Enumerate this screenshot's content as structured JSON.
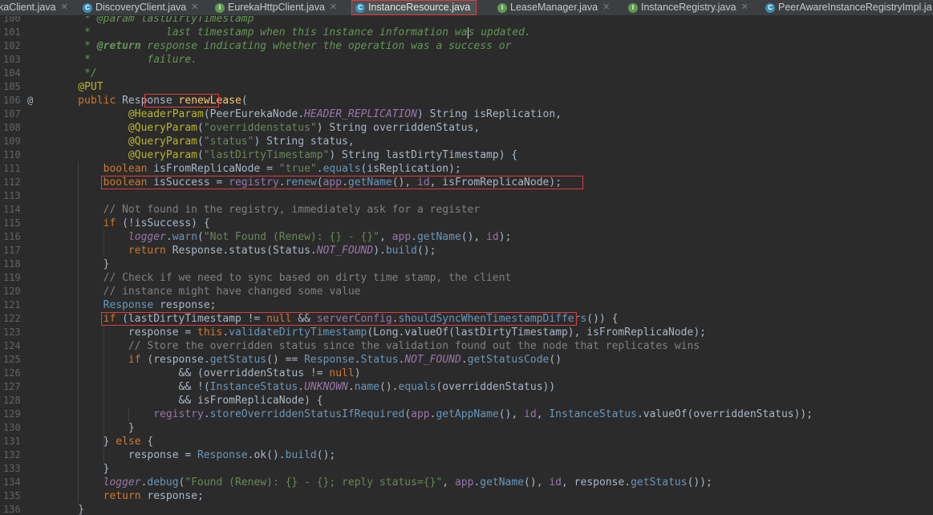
{
  "tabs": [
    {
      "label": "kaClient.java",
      "icon": "class-icon",
      "active": false
    },
    {
      "label": "DiscoveryClient.java",
      "icon": "class-icon",
      "active": false
    },
    {
      "label": "EurekaHttpClient.java",
      "icon": "interface-icon",
      "active": false
    },
    {
      "label": "InstanceResource.java",
      "icon": "class-icon",
      "active": true
    },
    {
      "label": "LeaseManager.java",
      "icon": "interface-icon",
      "active": false
    },
    {
      "label": "InstanceRegistry.java",
      "icon": "interface-icon",
      "active": false
    },
    {
      "label": "PeerAwareInstanceRegistryImpl.ja",
      "icon": "class-icon",
      "active": false
    }
  ],
  "colors": {
    "background": "#2b2b2b",
    "keyword": "#cc7832",
    "string": "#6a8759",
    "comment": "#629755",
    "annotation": "#bbb529",
    "highlight_box": "#e03c3c"
  },
  "lines": [
    {
      "n": "100",
      "tokens": [
        [
          "comment",
          "     * @param "
        ],
        [
          "comment",
          "lastDirtyTimestamp"
        ]
      ]
    },
    {
      "n": "101",
      "tokens": [
        [
          "comment",
          "     *            last timestamp when this instance information wa"
        ],
        [
          "caret",
          ""
        ],
        [
          "comment",
          "s updated."
        ]
      ]
    },
    {
      "n": "102",
      "tokens": [
        [
          "comment",
          "     * "
        ],
        [
          "tag",
          "@return"
        ],
        [
          "comment",
          " response indicating whether the operation was a success or"
        ]
      ]
    },
    {
      "n": "103",
      "tokens": [
        [
          "comment",
          "     *         failure."
        ]
      ]
    },
    {
      "n": "104",
      "tokens": [
        [
          "comment",
          "     */"
        ]
      ]
    },
    {
      "n": "105",
      "tokens": [
        [
          "annotation",
          "    @PUT"
        ]
      ]
    },
    {
      "n": "106",
      "mark": "@",
      "tokens": [
        [
          "keyword",
          "    public "
        ],
        [
          "default",
          "Response "
        ],
        [
          "static",
          "renewLease"
        ],
        [
          "default",
          "("
        ]
      ]
    },
    {
      "n": "107",
      "tokens": [
        [
          "annotation",
          "            @HeaderParam"
        ],
        [
          "default",
          "(PeerEurekaNode."
        ],
        [
          "const",
          "HEADER_REPLICATION"
        ],
        [
          "default",
          ") String isReplication,"
        ]
      ]
    },
    {
      "n": "108",
      "tokens": [
        [
          "annotation",
          "            @QueryParam"
        ],
        [
          "default",
          "("
        ],
        [
          "string",
          "\"overriddenstatus\""
        ],
        [
          "default",
          ") String overriddenStatus,"
        ]
      ]
    },
    {
      "n": "109",
      "tokens": [
        [
          "annotation",
          "            @QueryParam"
        ],
        [
          "default",
          "("
        ],
        [
          "string",
          "\"status\""
        ],
        [
          "default",
          ") String status,"
        ]
      ]
    },
    {
      "n": "110",
      "tokens": [
        [
          "annotation",
          "            @QueryParam"
        ],
        [
          "default",
          "("
        ],
        [
          "string",
          "\"lastDirtyTimestamp\""
        ],
        [
          "default",
          ") String lastDirtyTimestamp) {"
        ]
      ]
    },
    {
      "n": "111",
      "tokens": [
        [
          "keyword",
          "        boolean "
        ],
        [
          "default",
          "isFromReplicaNode = "
        ],
        [
          "string",
          "\"true\""
        ],
        [
          "default",
          "."
        ],
        [
          "method",
          "equals"
        ],
        [
          "default",
          "(isReplication);"
        ]
      ]
    },
    {
      "n": "112",
      "tokens": [
        [
          "keyword",
          "        boolean "
        ],
        [
          "default",
          "isSuccess = "
        ],
        [
          "field",
          "registry"
        ],
        [
          "default",
          "."
        ],
        [
          "method",
          "renew"
        ],
        [
          "default",
          "("
        ],
        [
          "field",
          "app"
        ],
        [
          "default",
          "."
        ],
        [
          "method",
          "getName"
        ],
        [
          "default",
          "(), "
        ],
        [
          "field",
          "id"
        ],
        [
          "default",
          ", isFromReplicaNode);"
        ]
      ]
    },
    {
      "n": "113",
      "tokens": [
        [
          "default",
          ""
        ]
      ]
    },
    {
      "n": "114",
      "tokens": [
        [
          "lcomment",
          "        // Not found in the registry, immediately ask for a register"
        ]
      ]
    },
    {
      "n": "115",
      "tokens": [
        [
          "keyword",
          "        if "
        ],
        [
          "default",
          "(!isSuccess) {"
        ]
      ]
    },
    {
      "n": "116",
      "tokens": [
        [
          "const",
          "            logger"
        ],
        [
          "default",
          "."
        ],
        [
          "method",
          "warn"
        ],
        [
          "default",
          "("
        ],
        [
          "string",
          "\"Not Found (Renew): {} - {}\""
        ],
        [
          "default",
          ", "
        ],
        [
          "field",
          "app"
        ],
        [
          "default",
          "."
        ],
        [
          "method",
          "getName"
        ],
        [
          "default",
          "(), "
        ],
        [
          "field",
          "id"
        ],
        [
          "default",
          ");"
        ]
      ]
    },
    {
      "n": "117",
      "tokens": [
        [
          "keyword",
          "            return "
        ],
        [
          "default",
          "Response.status(Status."
        ],
        [
          "const",
          "NOT_FOUND"
        ],
        [
          "default",
          ")."
        ],
        [
          "method",
          "build"
        ],
        [
          "default",
          "();"
        ]
      ]
    },
    {
      "n": "118",
      "tokens": [
        [
          "default",
          "        }"
        ]
      ]
    },
    {
      "n": "119",
      "tokens": [
        [
          "lcomment",
          "        // Check if we need to sync based on dirty time stamp, the client"
        ]
      ]
    },
    {
      "n": "120",
      "tokens": [
        [
          "lcomment",
          "        // instance might have changed some value"
        ]
      ]
    },
    {
      "n": "121",
      "tokens": [
        [
          "type",
          "        Response "
        ],
        [
          "default",
          "response;"
        ]
      ]
    },
    {
      "n": "122",
      "tokens": [
        [
          "keyword",
          "        if "
        ],
        [
          "default",
          "(lastDirtyTimestamp != "
        ],
        [
          "keyword",
          "null "
        ],
        [
          "default",
          "&& "
        ],
        [
          "field",
          "serverConfig"
        ],
        [
          "default",
          "."
        ],
        [
          "method",
          "shouldSyncWhenTimestampDiffers"
        ],
        [
          "default",
          "()) {"
        ]
      ]
    },
    {
      "n": "123",
      "tokens": [
        [
          "default",
          "            response = "
        ],
        [
          "keyword",
          "this"
        ],
        [
          "default",
          "."
        ],
        [
          "method",
          "validateDirtyTimestamp"
        ],
        [
          "default",
          "(Long.valueOf(lastDirtyTimestamp), isFromReplicaNode);"
        ]
      ]
    },
    {
      "n": "124",
      "tokens": [
        [
          "lcomment",
          "            // Store the overridden status since the validation found out the node that replicates wins"
        ]
      ]
    },
    {
      "n": "125",
      "tokens": [
        [
          "keyword",
          "            if "
        ],
        [
          "default",
          "(response."
        ],
        [
          "method",
          "getStatus"
        ],
        [
          "default",
          "() == "
        ],
        [
          "type",
          "Response"
        ],
        [
          "default",
          "."
        ],
        [
          "type",
          "Status"
        ],
        [
          "default",
          "."
        ],
        [
          "const",
          "NOT_FOUND"
        ],
        [
          "default",
          "."
        ],
        [
          "method",
          "getStatusCode"
        ],
        [
          "default",
          "()"
        ]
      ]
    },
    {
      "n": "126",
      "tokens": [
        [
          "default",
          "                    && (overriddenStatus != "
        ],
        [
          "keyword",
          "null"
        ],
        [
          "default",
          ")"
        ]
      ]
    },
    {
      "n": "127",
      "tokens": [
        [
          "default",
          "                    && !("
        ],
        [
          "type",
          "InstanceStatus"
        ],
        [
          "default",
          "."
        ],
        [
          "const",
          "UNKNOWN"
        ],
        [
          "default",
          "."
        ],
        [
          "method",
          "name"
        ],
        [
          "default",
          "()."
        ],
        [
          "method",
          "equals"
        ],
        [
          "default",
          "(overriddenStatus))"
        ]
      ]
    },
    {
      "n": "128",
      "tokens": [
        [
          "default",
          "                    && isFromReplicaNode) {"
        ]
      ]
    },
    {
      "n": "129",
      "tokens": [
        [
          "field",
          "                registry"
        ],
        [
          "default",
          "."
        ],
        [
          "method",
          "storeOverriddenStatusIfRequired"
        ],
        [
          "default",
          "("
        ],
        [
          "field",
          "app"
        ],
        [
          "default",
          "."
        ],
        [
          "method",
          "getAppName"
        ],
        [
          "default",
          "(), "
        ],
        [
          "field",
          "id"
        ],
        [
          "default",
          ", "
        ],
        [
          "type",
          "InstanceStatus"
        ],
        [
          "default",
          ".valueOf(overriddenStatus));"
        ]
      ]
    },
    {
      "n": "130",
      "tokens": [
        [
          "default",
          "            }"
        ]
      ]
    },
    {
      "n": "131",
      "tokens": [
        [
          "default",
          "        } "
        ],
        [
          "keyword",
          "else "
        ],
        [
          "default",
          "{"
        ]
      ]
    },
    {
      "n": "132",
      "tokens": [
        [
          "default",
          "            response = "
        ],
        [
          "type",
          "Response"
        ],
        [
          "default",
          ".ok()."
        ],
        [
          "method",
          "build"
        ],
        [
          "default",
          "();"
        ]
      ]
    },
    {
      "n": "133",
      "tokens": [
        [
          "default",
          "        }"
        ]
      ]
    },
    {
      "n": "134",
      "tokens": [
        [
          "const",
          "        logger"
        ],
        [
          "default",
          "."
        ],
        [
          "method",
          "debug"
        ],
        [
          "default",
          "("
        ],
        [
          "string",
          "\"Found (Renew): {} - {}; reply status={}\""
        ],
        [
          "default",
          ", "
        ],
        [
          "field",
          "app"
        ],
        [
          "default",
          "."
        ],
        [
          "method",
          "getName"
        ],
        [
          "default",
          "(), "
        ],
        [
          "field",
          "id"
        ],
        [
          "default",
          ", response."
        ],
        [
          "method",
          "getStatus"
        ],
        [
          "default",
          "());"
        ]
      ]
    },
    {
      "n": "135",
      "tokens": [
        [
          "keyword",
          "        return "
        ],
        [
          "default",
          "response;"
        ]
      ]
    },
    {
      "n": "136",
      "tokens": [
        [
          "default",
          "    }"
        ]
      ]
    }
  ]
}
